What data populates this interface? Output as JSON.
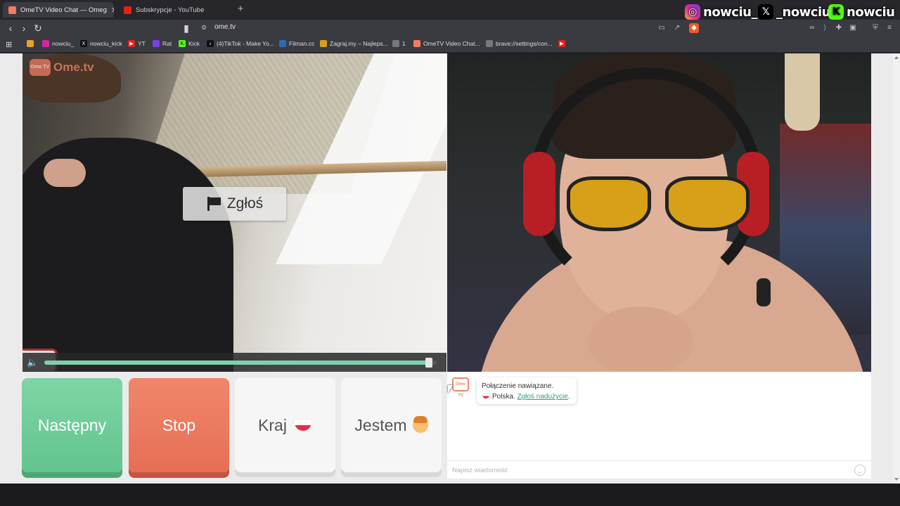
{
  "browser": {
    "tabs": [
      {
        "title": "OmeTV Video Chat — Omeg",
        "color": "#f37b62",
        "active": true
      },
      {
        "title": "Subskrypcje - YouTube",
        "color": "#e62117",
        "active": false
      }
    ],
    "new_tab_label": "+",
    "close_label": "✕",
    "url": "ome.tv",
    "bookmarks": [
      {
        "label": "nowciu_",
        "color": "#d6249f"
      },
      {
        "label": "nowciu_kick",
        "color": "#111111"
      },
      {
        "label": "YT",
        "color": "#e62117"
      },
      {
        "label": "Rat",
        "color": "#7b3fe4"
      },
      {
        "label": "Kick",
        "color": "#53fc18"
      },
      {
        "label": "(4)TikTok - Make Yo...",
        "color": "#111111"
      },
      {
        "label": "Filman.cc",
        "color": "#2b6cb0"
      },
      {
        "label": "Zagraj.my – Najleps...",
        "color": "#d4a017"
      },
      {
        "label": "1",
        "color": "#777777"
      },
      {
        "label": "OmeTV Video Chat...",
        "color": "#f37b62"
      },
      {
        "label": "brave://settings/con...",
        "color": "#777777"
      }
    ]
  },
  "overlay": {
    "instagram": "nowciu_",
    "x": "_nowciu",
    "kick": "nowciu"
  },
  "app": {
    "logo_text": "Ome.tv",
    "logo_badge": "Ome TV",
    "report_label": "Zgłoś",
    "volume_level": 0.98,
    "buttons": {
      "next": "Następny",
      "stop": "Stop",
      "country": "Kraj",
      "gender": "Jestem"
    },
    "chat": {
      "avatar_text": "Ome TV",
      "message_line1": "Połączenie nawiązane.",
      "message_country": "Polska.",
      "message_link": "Zgłoś nadużycie",
      "message_end": ".",
      "input_placeholder": "Napisz wiadomość"
    }
  },
  "colors": {
    "next": "#6fcc99",
    "stop": "#ea7a60",
    "accent": "#2e9c85"
  }
}
